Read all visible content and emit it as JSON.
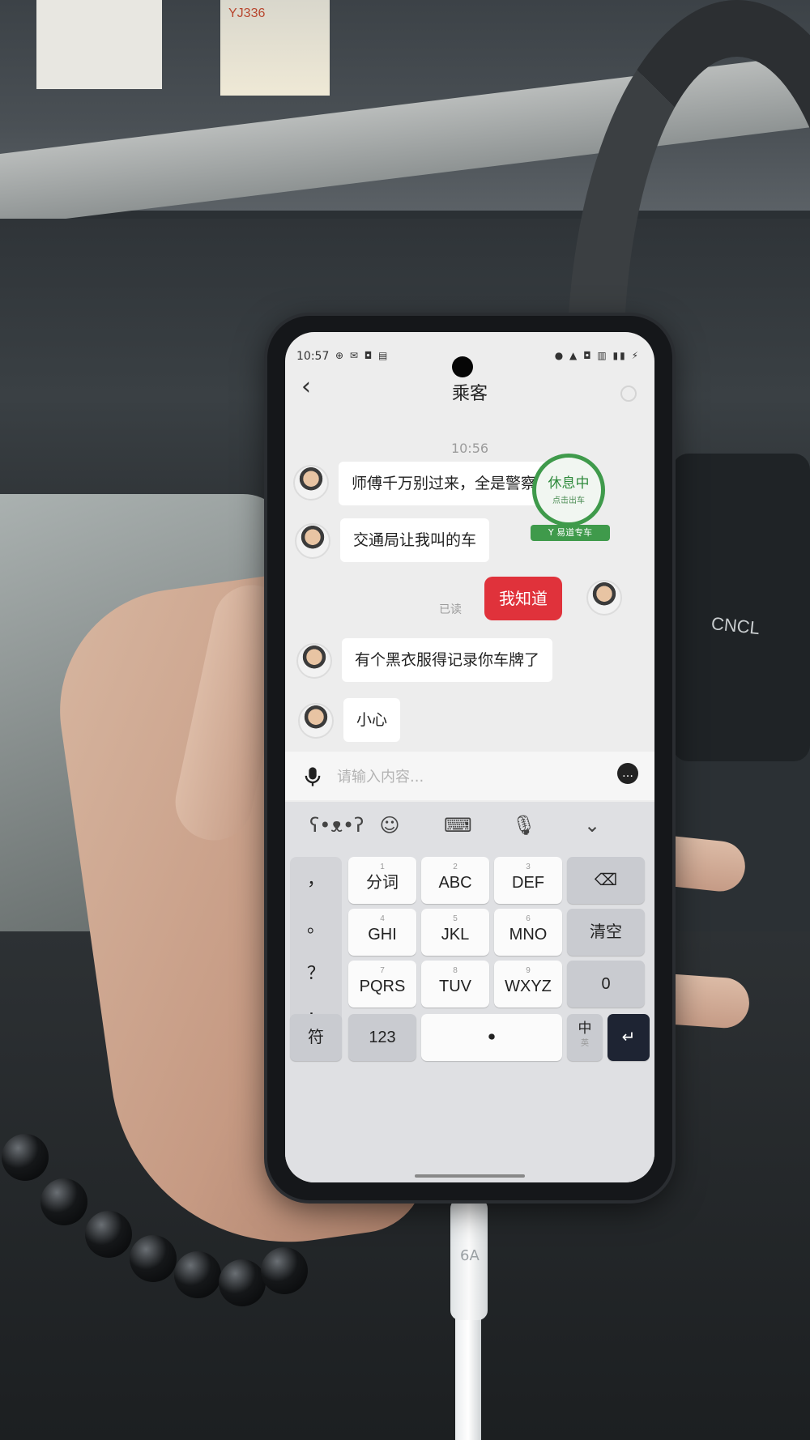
{
  "status_bar": {
    "time": "10:57",
    "left_icons": "⊕ ✉ ◘ ▤",
    "right_icons": "● ▲ ◘ ▥ ▮▮ ⚡"
  },
  "background": {
    "window_sign_text": "YJ336"
  },
  "header": {
    "back_icon": "chevron-left-icon",
    "title": "乘客"
  },
  "chat": {
    "timestamp": "10:56",
    "messages": [
      {
        "side": "incoming",
        "text": "师傅千万别过来，全是警察，"
      },
      {
        "side": "incoming",
        "text": "交通局让我叫的车"
      },
      {
        "side": "outgoing",
        "text": "我知道",
        "status": "已读"
      },
      {
        "side": "incoming",
        "text": "有个黑衣服得记录你车牌了"
      },
      {
        "side": "incoming",
        "text": "小心"
      }
    ],
    "accent_color": "#e0323b"
  },
  "status_stamp": {
    "main": "休息中",
    "sub": "点击出车",
    "tag": "Y 易道专车",
    "color": "#3f9a4b"
  },
  "input": {
    "placeholder": "请输入内容..."
  },
  "keyboard": {
    "toolbar": [
      "emoji-bear-icon",
      "smiley-icon",
      "keyboard-icon",
      "mic-icon",
      "collapse-icon"
    ],
    "punctuation": [
      "，",
      "。",
      "？",
      "！"
    ],
    "rows": [
      [
        {
          "num": "1",
          "label": "分词"
        },
        {
          "num": "2",
          "label": "ABC"
        },
        {
          "num": "3",
          "label": "DEF"
        }
      ],
      [
        {
          "num": "4",
          "label": "GHI"
        },
        {
          "num": "5",
          "label": "JKL"
        },
        {
          "num": "6",
          "label": "MNO"
        }
      ],
      [
        {
          "num": "7",
          "label": "PQRS"
        },
        {
          "num": "8",
          "label": "TUV"
        },
        {
          "num": "9",
          "label": "WXYZ"
        }
      ]
    ],
    "right_keys": {
      "clear": "清空",
      "zero": "0"
    },
    "bottom": {
      "symbols": "符",
      "numbers": "123",
      "lang_main": "中",
      "lang_sub": "英"
    }
  },
  "cable_label": "6A",
  "console_label": "CNCL"
}
